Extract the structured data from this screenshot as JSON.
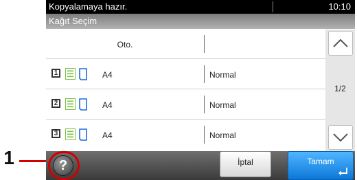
{
  "callout": {
    "number": "1"
  },
  "status": {
    "message": "Kopyalamaya hazır.",
    "time": "10:10"
  },
  "title": "Kağıt Seçim",
  "rows": [
    {
      "label": "Oto.",
      "paper_size": "",
      "paper_type": ""
    },
    {
      "tray_number": "1",
      "paper_size": "A4",
      "paper_type": "Normal"
    },
    {
      "tray_number": "2",
      "paper_size": "A4",
      "paper_type": "Normal"
    },
    {
      "tray_number": "3",
      "paper_size": "A4",
      "paper_type": "Normal"
    }
  ],
  "scroll": {
    "page": "1/2"
  },
  "buttons": {
    "cancel": "İptal",
    "ok": "Tamam"
  },
  "icons": {
    "help": "help-icon",
    "scroll_up": "chevron-up-icon",
    "scroll_down": "chevron-down-icon",
    "enter": "enter-icon",
    "paper_stack": "paper-stack-icon",
    "sheet": "paper-sheet-icon"
  },
  "colors": {
    "callout": "#d40000",
    "ok_button": "#1a8fe8",
    "paper_stack": "#7bc242",
    "sheet": "#1a6fd6"
  }
}
